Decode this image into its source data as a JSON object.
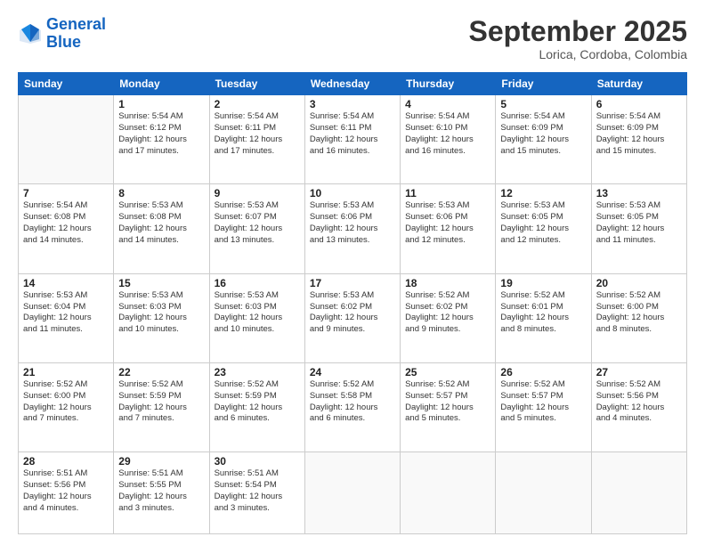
{
  "header": {
    "logo_line1": "General",
    "logo_line2": "Blue",
    "month": "September 2025",
    "location": "Lorica, Cordoba, Colombia"
  },
  "weekdays": [
    "Sunday",
    "Monday",
    "Tuesday",
    "Wednesday",
    "Thursday",
    "Friday",
    "Saturday"
  ],
  "weeks": [
    [
      {
        "day": "",
        "sunrise": "",
        "sunset": "",
        "daylight": ""
      },
      {
        "day": "1",
        "sunrise": "Sunrise: 5:54 AM",
        "sunset": "Sunset: 6:12 PM",
        "daylight": "Daylight: 12 hours and 17 minutes."
      },
      {
        "day": "2",
        "sunrise": "Sunrise: 5:54 AM",
        "sunset": "Sunset: 6:11 PM",
        "daylight": "Daylight: 12 hours and 17 minutes."
      },
      {
        "day": "3",
        "sunrise": "Sunrise: 5:54 AM",
        "sunset": "Sunset: 6:11 PM",
        "daylight": "Daylight: 12 hours and 16 minutes."
      },
      {
        "day": "4",
        "sunrise": "Sunrise: 5:54 AM",
        "sunset": "Sunset: 6:10 PM",
        "daylight": "Daylight: 12 hours and 16 minutes."
      },
      {
        "day": "5",
        "sunrise": "Sunrise: 5:54 AM",
        "sunset": "Sunset: 6:09 PM",
        "daylight": "Daylight: 12 hours and 15 minutes."
      },
      {
        "day": "6",
        "sunrise": "Sunrise: 5:54 AM",
        "sunset": "Sunset: 6:09 PM",
        "daylight": "Daylight: 12 hours and 15 minutes."
      }
    ],
    [
      {
        "day": "7",
        "sunrise": "Sunrise: 5:54 AM",
        "sunset": "Sunset: 6:08 PM",
        "daylight": "Daylight: 12 hours and 14 minutes."
      },
      {
        "day": "8",
        "sunrise": "Sunrise: 5:53 AM",
        "sunset": "Sunset: 6:08 PM",
        "daylight": "Daylight: 12 hours and 14 minutes."
      },
      {
        "day": "9",
        "sunrise": "Sunrise: 5:53 AM",
        "sunset": "Sunset: 6:07 PM",
        "daylight": "Daylight: 12 hours and 13 minutes."
      },
      {
        "day": "10",
        "sunrise": "Sunrise: 5:53 AM",
        "sunset": "Sunset: 6:06 PM",
        "daylight": "Daylight: 12 hours and 13 minutes."
      },
      {
        "day": "11",
        "sunrise": "Sunrise: 5:53 AM",
        "sunset": "Sunset: 6:06 PM",
        "daylight": "Daylight: 12 hours and 12 minutes."
      },
      {
        "day": "12",
        "sunrise": "Sunrise: 5:53 AM",
        "sunset": "Sunset: 6:05 PM",
        "daylight": "Daylight: 12 hours and 12 minutes."
      },
      {
        "day": "13",
        "sunrise": "Sunrise: 5:53 AM",
        "sunset": "Sunset: 6:05 PM",
        "daylight": "Daylight: 12 hours and 11 minutes."
      }
    ],
    [
      {
        "day": "14",
        "sunrise": "Sunrise: 5:53 AM",
        "sunset": "Sunset: 6:04 PM",
        "daylight": "Daylight: 12 hours and 11 minutes."
      },
      {
        "day": "15",
        "sunrise": "Sunrise: 5:53 AM",
        "sunset": "Sunset: 6:03 PM",
        "daylight": "Daylight: 12 hours and 10 minutes."
      },
      {
        "day": "16",
        "sunrise": "Sunrise: 5:53 AM",
        "sunset": "Sunset: 6:03 PM",
        "daylight": "Daylight: 12 hours and 10 minutes."
      },
      {
        "day": "17",
        "sunrise": "Sunrise: 5:53 AM",
        "sunset": "Sunset: 6:02 PM",
        "daylight": "Daylight: 12 hours and 9 minutes."
      },
      {
        "day": "18",
        "sunrise": "Sunrise: 5:52 AM",
        "sunset": "Sunset: 6:02 PM",
        "daylight": "Daylight: 12 hours and 9 minutes."
      },
      {
        "day": "19",
        "sunrise": "Sunrise: 5:52 AM",
        "sunset": "Sunset: 6:01 PM",
        "daylight": "Daylight: 12 hours and 8 minutes."
      },
      {
        "day": "20",
        "sunrise": "Sunrise: 5:52 AM",
        "sunset": "Sunset: 6:00 PM",
        "daylight": "Daylight: 12 hours and 8 minutes."
      }
    ],
    [
      {
        "day": "21",
        "sunrise": "Sunrise: 5:52 AM",
        "sunset": "Sunset: 6:00 PM",
        "daylight": "Daylight: 12 hours and 7 minutes."
      },
      {
        "day": "22",
        "sunrise": "Sunrise: 5:52 AM",
        "sunset": "Sunset: 5:59 PM",
        "daylight": "Daylight: 12 hours and 7 minutes."
      },
      {
        "day": "23",
        "sunrise": "Sunrise: 5:52 AM",
        "sunset": "Sunset: 5:59 PM",
        "daylight": "Daylight: 12 hours and 6 minutes."
      },
      {
        "day": "24",
        "sunrise": "Sunrise: 5:52 AM",
        "sunset": "Sunset: 5:58 PM",
        "daylight": "Daylight: 12 hours and 6 minutes."
      },
      {
        "day": "25",
        "sunrise": "Sunrise: 5:52 AM",
        "sunset": "Sunset: 5:57 PM",
        "daylight": "Daylight: 12 hours and 5 minutes."
      },
      {
        "day": "26",
        "sunrise": "Sunrise: 5:52 AM",
        "sunset": "Sunset: 5:57 PM",
        "daylight": "Daylight: 12 hours and 5 minutes."
      },
      {
        "day": "27",
        "sunrise": "Sunrise: 5:52 AM",
        "sunset": "Sunset: 5:56 PM",
        "daylight": "Daylight: 12 hours and 4 minutes."
      }
    ],
    [
      {
        "day": "28",
        "sunrise": "Sunrise: 5:51 AM",
        "sunset": "Sunset: 5:56 PM",
        "daylight": "Daylight: 12 hours and 4 minutes."
      },
      {
        "day": "29",
        "sunrise": "Sunrise: 5:51 AM",
        "sunset": "Sunset: 5:55 PM",
        "daylight": "Daylight: 12 hours and 3 minutes."
      },
      {
        "day": "30",
        "sunrise": "Sunrise: 5:51 AM",
        "sunset": "Sunset: 5:54 PM",
        "daylight": "Daylight: 12 hours and 3 minutes."
      },
      {
        "day": "",
        "sunrise": "",
        "sunset": "",
        "daylight": ""
      },
      {
        "day": "",
        "sunrise": "",
        "sunset": "",
        "daylight": ""
      },
      {
        "day": "",
        "sunrise": "",
        "sunset": "",
        "daylight": ""
      },
      {
        "day": "",
        "sunrise": "",
        "sunset": "",
        "daylight": ""
      }
    ]
  ]
}
